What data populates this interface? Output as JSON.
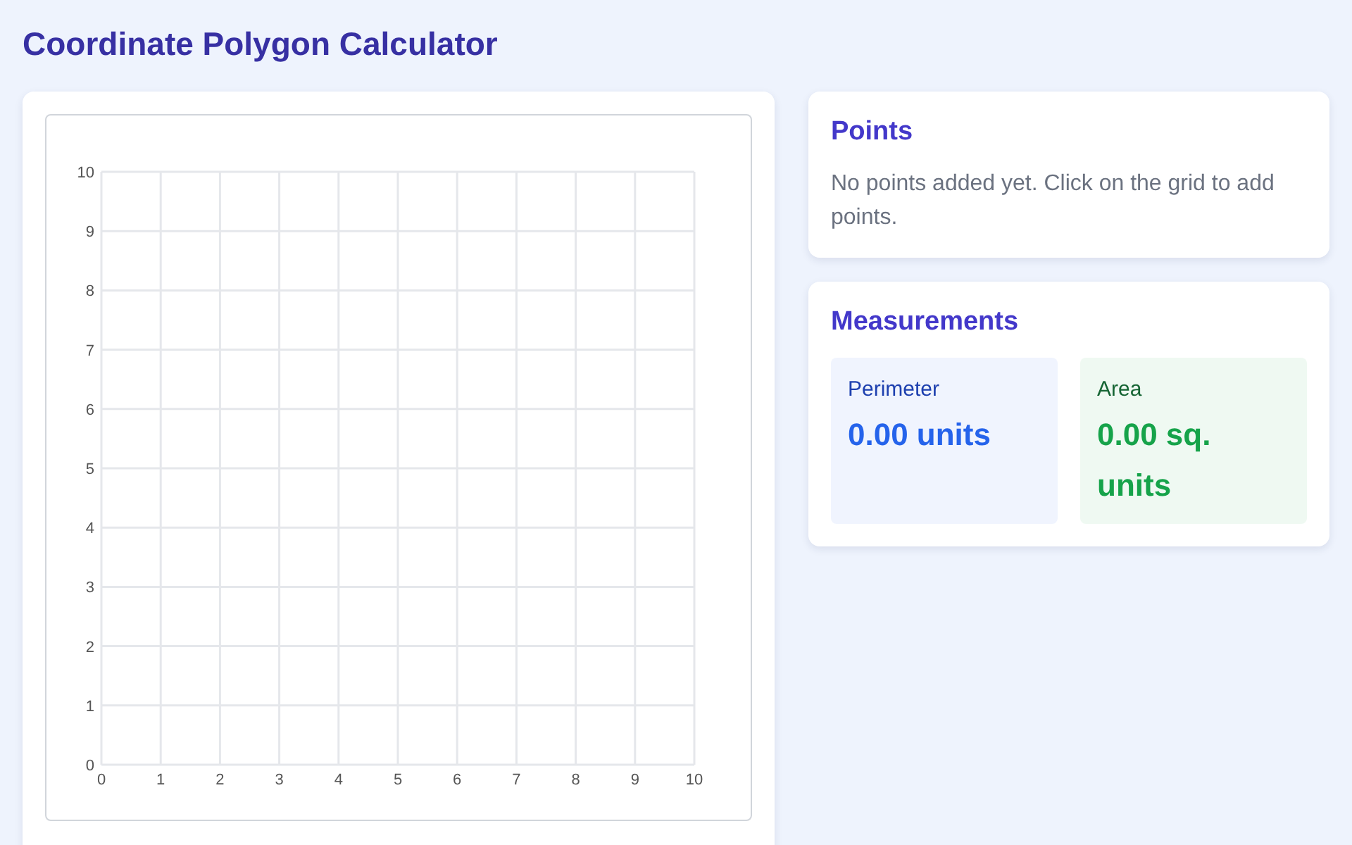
{
  "title": "Coordinate Polygon Calculator",
  "grid": {
    "chart_data": {
      "type": "scatter",
      "grid": true,
      "xlim": [
        0,
        10
      ],
      "ylim": [
        0,
        10
      ],
      "xticks": [
        0,
        1,
        2,
        3,
        4,
        5,
        6,
        7,
        8,
        9,
        10
      ],
      "yticks": [
        0,
        1,
        2,
        3,
        4,
        5,
        6,
        7,
        8,
        9,
        10
      ]
    }
  },
  "points": {
    "heading": "Points",
    "empty_message": "No points added yet. Click on the grid to add points."
  },
  "measurements": {
    "heading": "Measurements",
    "items": [
      {
        "label": "Perimeter",
        "value": "0.00 units",
        "color": "#2563eb"
      },
      {
        "label": "Area",
        "value": "0.00 sq. units",
        "color": "#16a34a"
      }
    ]
  }
}
